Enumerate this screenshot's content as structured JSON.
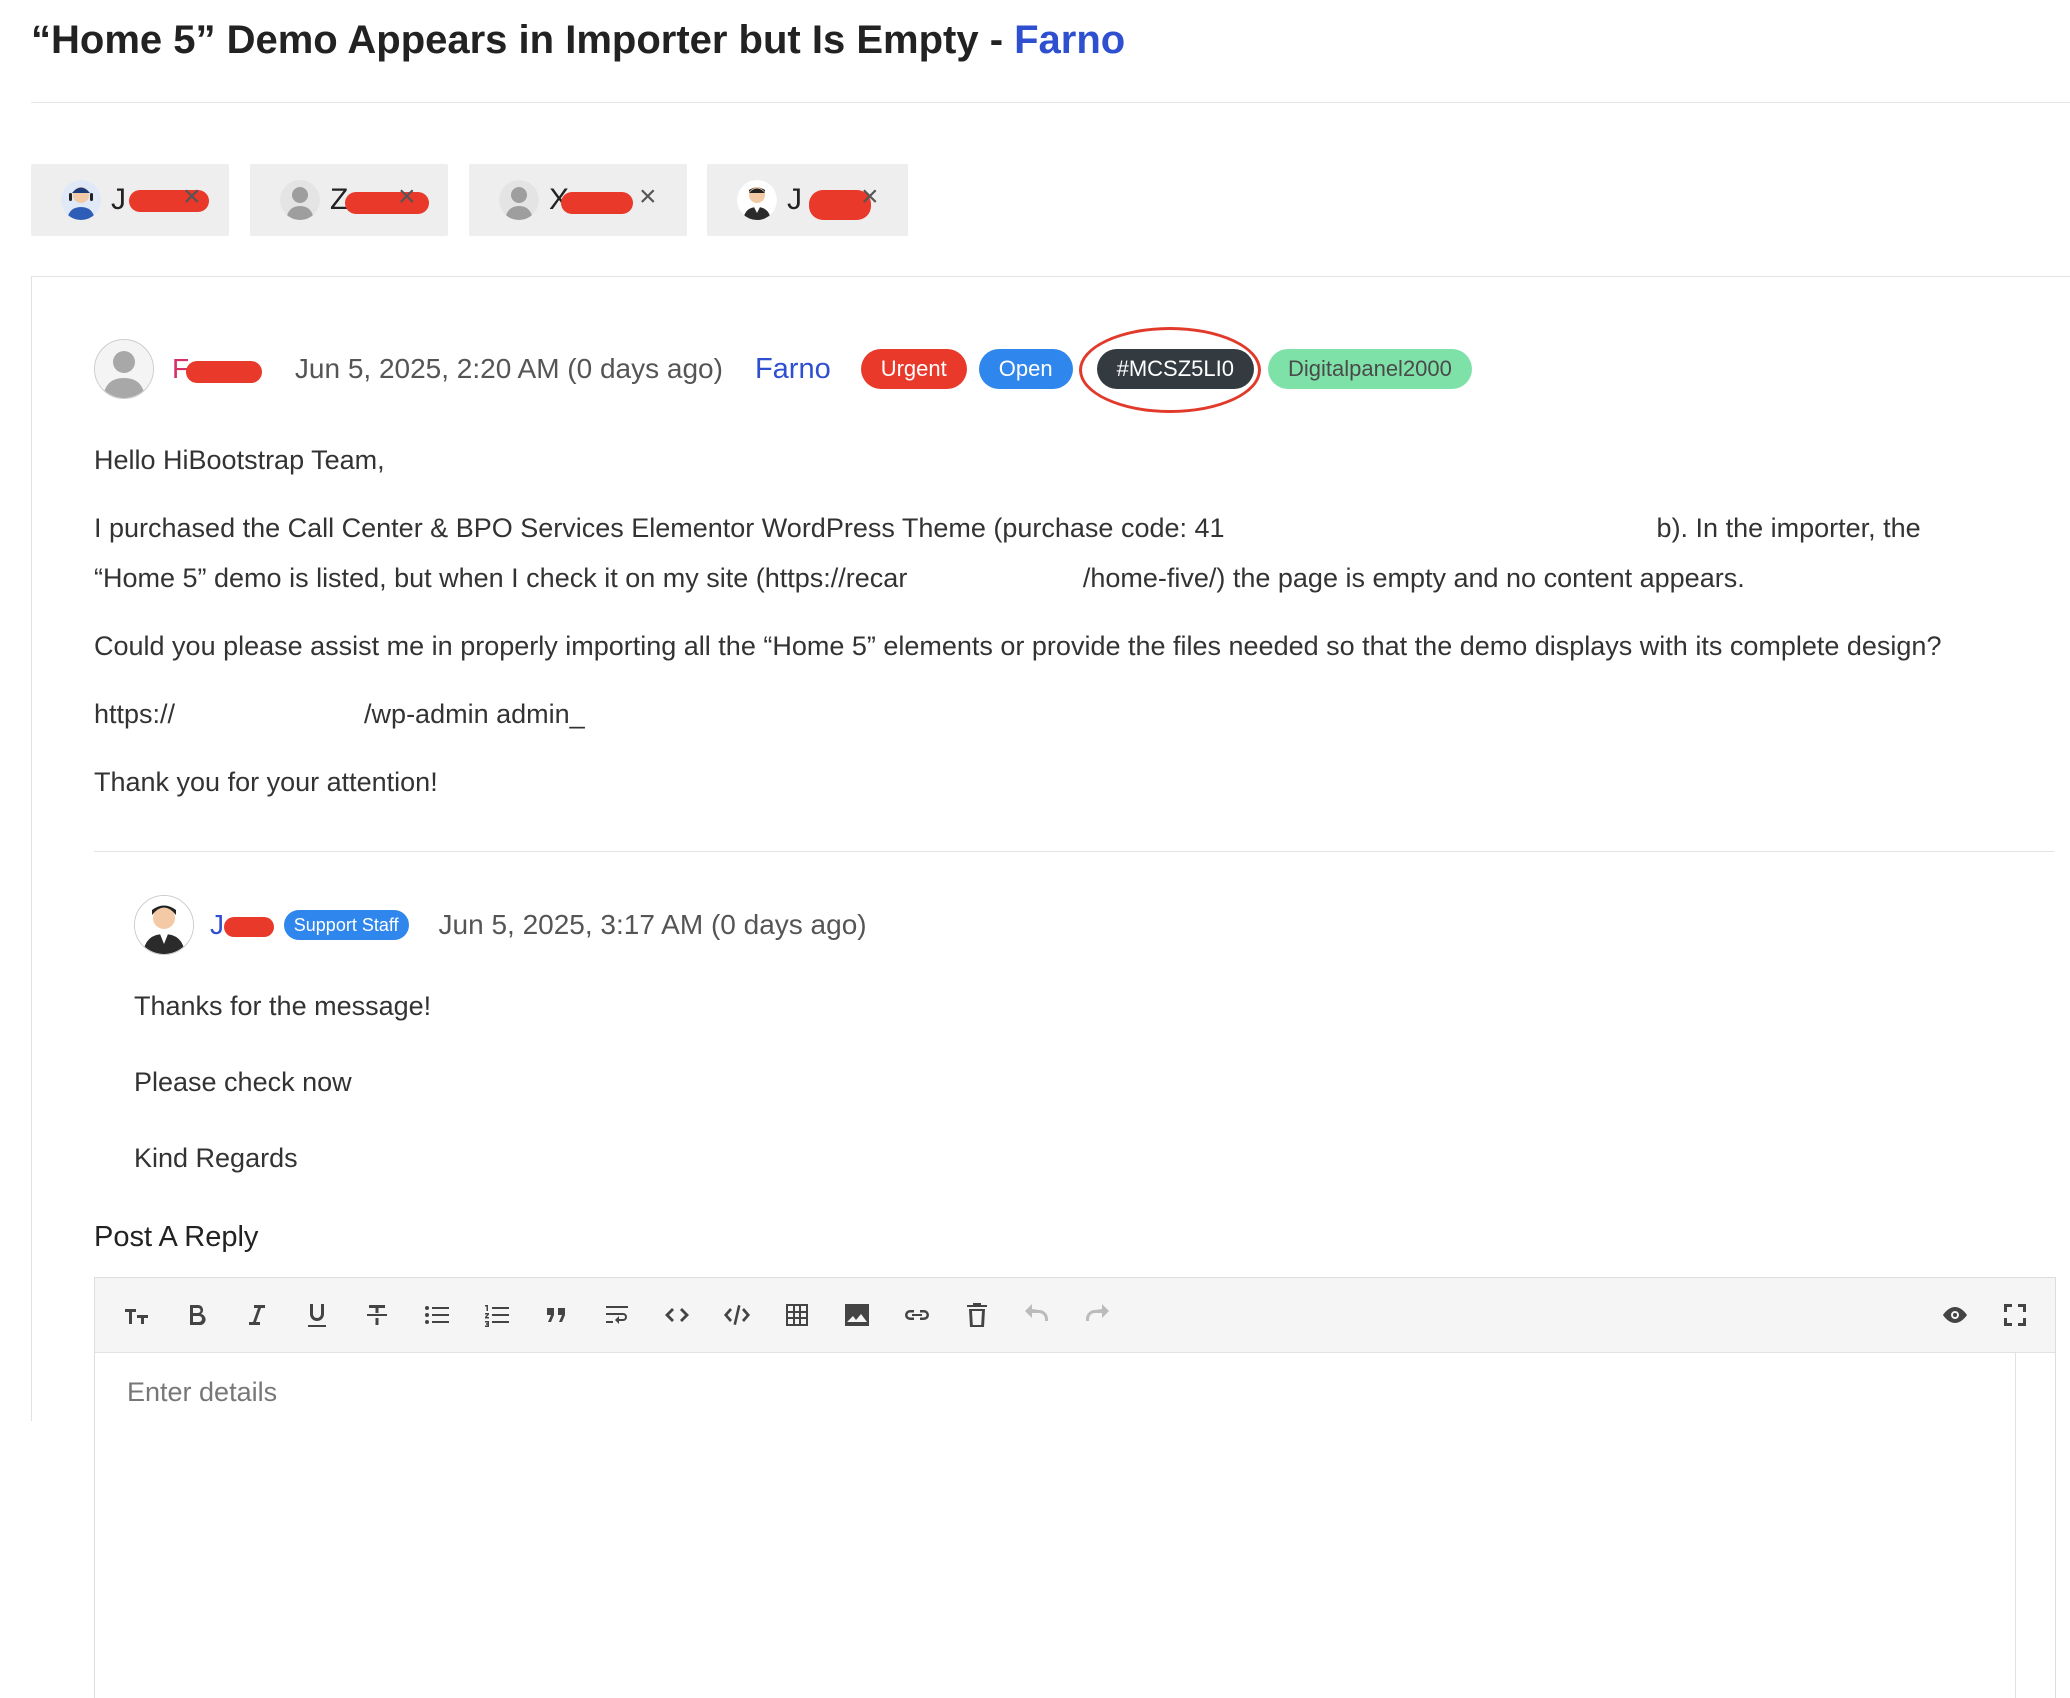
{
  "ticket": {
    "title": "“Home 5” Demo Appears in Importer but Is Empty - ",
    "product": "Farno"
  },
  "assignees": [
    {
      "name": "J"
    },
    {
      "name": "Z"
    },
    {
      "name": "X"
    },
    {
      "name": "J"
    }
  ],
  "remove_glyph": "×",
  "message": {
    "author": "F",
    "date": "Jun 5, 2025, 2:20 AM (0 days ago)",
    "product": "Farno",
    "priority": "Urgent",
    "status": "Open",
    "ticket_id": "#MCSZ5LI0",
    "username": "Digitalpanel2000",
    "greeting": "Hello HiBootstrap Team,",
    "p1a": "I purchased the Call Center & BPO Services Elementor WordPress Theme (purchase code: 41",
    "p1b": "b). In the importer, the",
    "p1c": "“Home 5” demo is listed, but when I check it on my site (https://recar",
    "p1d": "/home-five/) the page is empty and no content appears.",
    "p2": "Could you please assist me in properly importing all the “Home 5” elements or provide the files needed so that the demo displays with its complete design?",
    "link_a": "https://",
    "link_b": "/wp-admin",
    "link_c": "admin_",
    "thanks": "Thank you for your attention!"
  },
  "reply": {
    "author": "J",
    "staff_badge": "Support Staff",
    "date": "Jun 5, 2025, 3:17 AM (0 days ago)",
    "lines": [
      "Thanks for the message!",
      "Please check now",
      "Kind Regards"
    ]
  },
  "post_reply": {
    "label": "Post A Reply",
    "placeholder": "Enter details"
  },
  "colors": {
    "brand": "#2e4fcf",
    "urgent": "#e8392a",
    "open": "#2f86ec",
    "ticket_id": "#333a40",
    "username_badge": "#7ee2a8"
  },
  "toolbar_icons": [
    "heading-icon",
    "bold-icon",
    "italic-icon",
    "underline-icon",
    "strikethrough-icon",
    "bullet-list-icon",
    "numbered-list-icon",
    "quote-icon",
    "wrap-icon",
    "code-icon",
    "code-block-icon",
    "table-icon",
    "image-icon",
    "link-icon",
    "delete-icon",
    "undo-icon",
    "redo-icon",
    "preview-icon",
    "fullscreen-icon"
  ]
}
